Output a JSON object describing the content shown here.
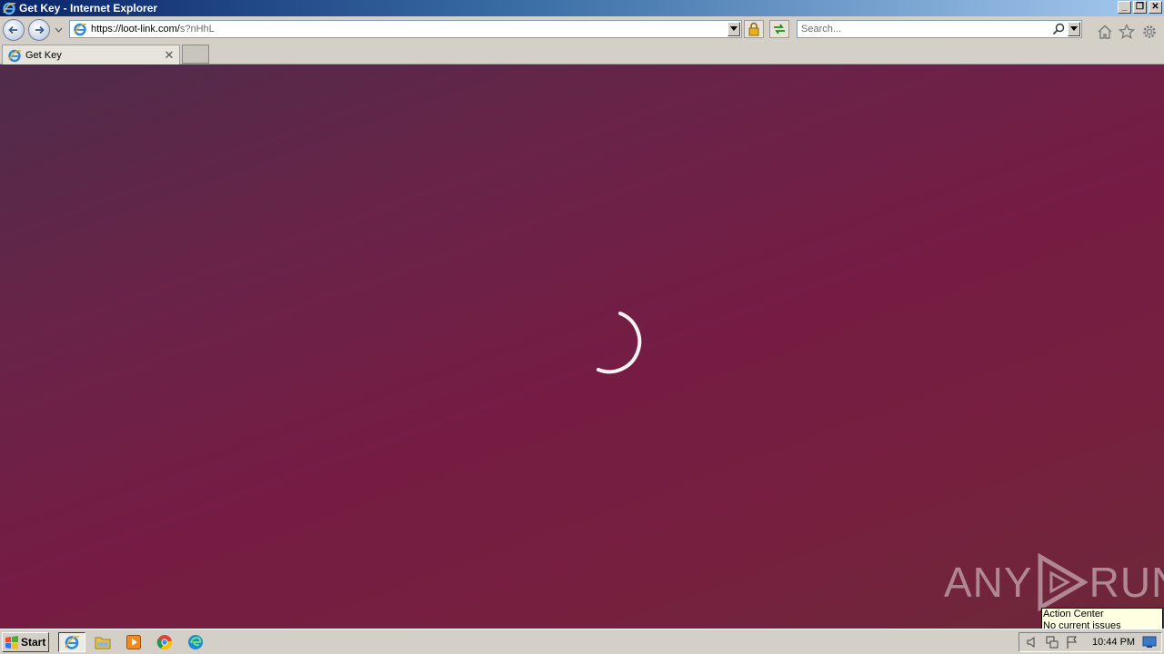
{
  "window": {
    "title": "Get Key - Internet Explorer",
    "buttons": {
      "minimize": "_",
      "restore": "❐",
      "close": "✕"
    }
  },
  "navbar": {
    "url_main": "https://loot-link.com/",
    "url_dim": "s?nHhL",
    "search_placeholder": "Search..."
  },
  "tabs": [
    {
      "label": "Get Key",
      "close": "✕",
      "active": true
    }
  ],
  "content": {
    "background_colors": [
      "#4f2c4a",
      "#761c43",
      "#6e2839"
    ],
    "loading": true
  },
  "watermark": {
    "left": "ANY",
    "right": "RUN"
  },
  "tooltip": {
    "title": "Action Center",
    "body": "No current issues detected"
  },
  "taskbar": {
    "start_label": "Start",
    "apps": [
      "internet-explorer-icon",
      "file-explorer-icon",
      "media-player-icon",
      "chrome-icon",
      "edge-icon"
    ],
    "clock": "10:44 PM"
  }
}
